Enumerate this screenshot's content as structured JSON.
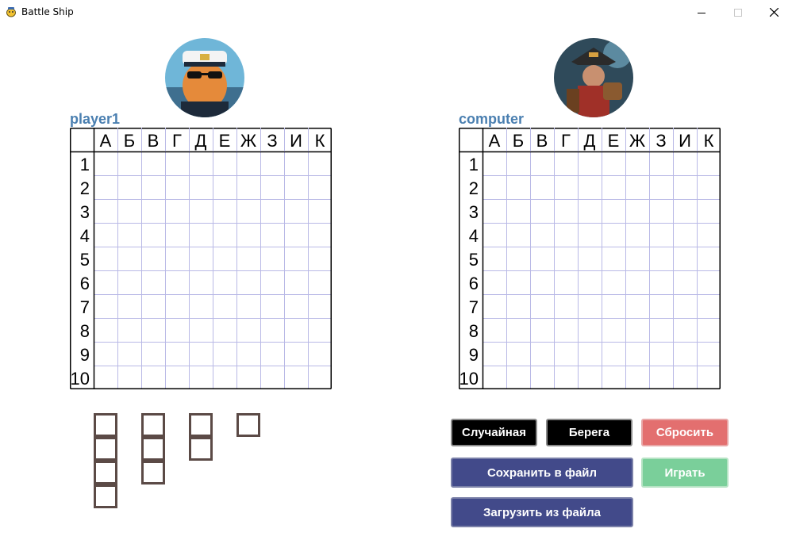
{
  "window": {
    "title": "Battle Ship"
  },
  "player1": {
    "name": "player1",
    "board": {
      "columns": [
        "А",
        "Б",
        "В",
        "Г",
        "Д",
        "Е",
        "Ж",
        "З",
        "И",
        "К"
      ],
      "rows": [
        "1",
        "2",
        "3",
        "4",
        "5",
        "6",
        "7",
        "8",
        "9",
        "10"
      ]
    }
  },
  "computer": {
    "name": "computer",
    "board": {
      "columns": [
        "А",
        "Б",
        "В",
        "Г",
        "Д",
        "Е",
        "Ж",
        "З",
        "И",
        "К"
      ],
      "rows": [
        "1",
        "2",
        "3",
        "4",
        "5",
        "6",
        "7",
        "8",
        "9",
        "10"
      ]
    }
  },
  "ships": [
    4,
    3,
    2,
    1
  ],
  "buttons": {
    "random": "Случайная",
    "shores": "Берега",
    "reset": "Сбросить",
    "save": "Сохранить в файл",
    "play": "Играть",
    "load": "Загрузить из файла"
  },
  "colors": {
    "name": "#4a7fb0",
    "grid": "#b9b9e6",
    "ship_border": "#5b4a46",
    "reset": "#e36f6f",
    "navy": "#424a8a",
    "play": "#7acf9a"
  }
}
